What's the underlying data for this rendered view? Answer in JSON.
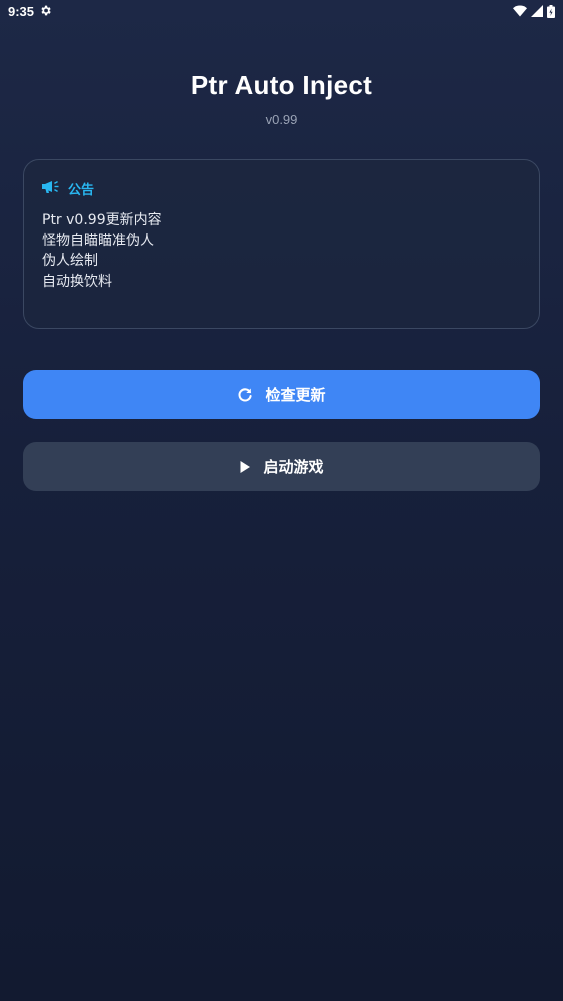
{
  "status_bar": {
    "time": "9:35",
    "icons": [
      "settings-icon",
      "wifi-icon",
      "signal-icon",
      "battery-icon"
    ]
  },
  "app": {
    "title": "Ptr Auto Inject",
    "version": "v0.99"
  },
  "notice": {
    "icon": "megaphone-icon",
    "title": "公告",
    "lines": [
      "Ptr v0.99更新内容",
      "怪物自瞄瞄准伪人",
      "伪人绘制",
      "自动换饮料"
    ]
  },
  "buttons": {
    "check_update": {
      "icon": "refresh-icon",
      "label": "检查更新"
    },
    "start_game": {
      "icon": "play-icon",
      "label": "启动游戏"
    }
  },
  "colors": {
    "accent": "#3f86f5",
    "notice_title": "#29b6f0",
    "secondary_button": "#333f56",
    "background_top": "#1d2846",
    "background_bottom": "#121a30"
  }
}
